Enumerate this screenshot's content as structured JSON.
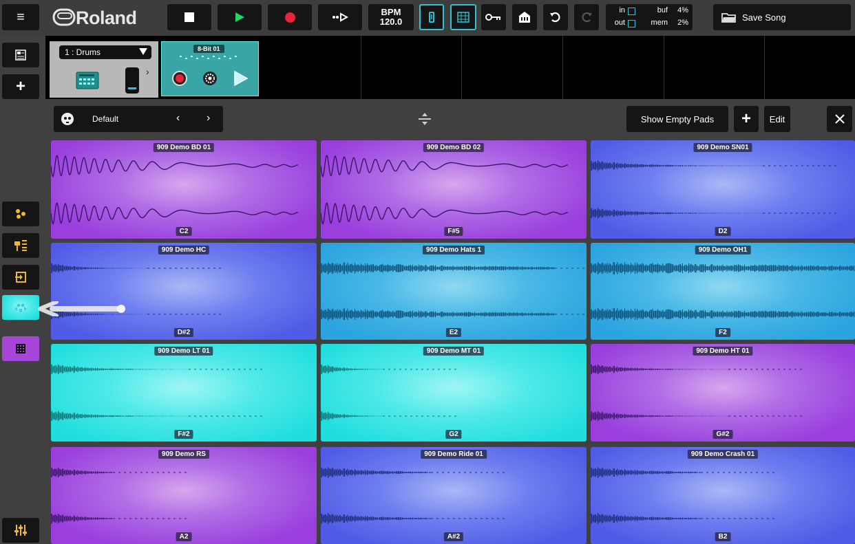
{
  "toolbar": {
    "bpm_label": "BPM",
    "bpm_value": "120.0",
    "meters": {
      "in_label": "in",
      "out_label": "out",
      "buf_label": "buf",
      "buf_value": "4%",
      "mem_label": "mem",
      "mem_value": "2%"
    },
    "save_label": "Save Song",
    "colors": {
      "play": "#1ed760",
      "record": "#e8233a",
      "accent": "#2ec4d6"
    }
  },
  "track": {
    "name": "1 : Drums",
    "clip_title": "8-Bit 01"
  },
  "kit": {
    "name": "Default",
    "show_empty_label": "Show Empty Pads",
    "edit_label": "Edit"
  },
  "pads": [
    {
      "name": "909 Demo BD 01",
      "note": "C2",
      "color": "purple",
      "wave": "bd"
    },
    {
      "name": "909 Demo BD 02",
      "note": "F#5",
      "color": "purple",
      "wave": "bd"
    },
    {
      "name": "909 Demo SN01",
      "note": "D2",
      "color": "blue",
      "wave": "sn"
    },
    {
      "name": "909 Demo HC",
      "note": "D#2",
      "color": "blue",
      "wave": "hc"
    },
    {
      "name": "909 Demo Hats 1",
      "note": "E2",
      "color": "sky",
      "wave": "hat"
    },
    {
      "name": "909 Demo OH1",
      "note": "F2",
      "color": "sky",
      "wave": "oh"
    },
    {
      "name": "909 Demo LT 01",
      "note": "F#2",
      "color": "cyan",
      "wave": "tom"
    },
    {
      "name": "909 Demo MT 01",
      "note": "G2",
      "color": "cyan",
      "wave": "tomshort"
    },
    {
      "name": "909 Demo HT 01",
      "note": "G#2",
      "color": "purple",
      "wave": "tom"
    },
    {
      "name": "909 Demo RS",
      "note": "A2",
      "color": "purple",
      "wave": "rs"
    },
    {
      "name": "909 Demo Ride 01",
      "note": "A#2",
      "color": "blue",
      "wave": "ride"
    },
    {
      "name": "909 Demo Crash 01",
      "note": "B2",
      "color": "blue",
      "wave": "ride"
    }
  ]
}
